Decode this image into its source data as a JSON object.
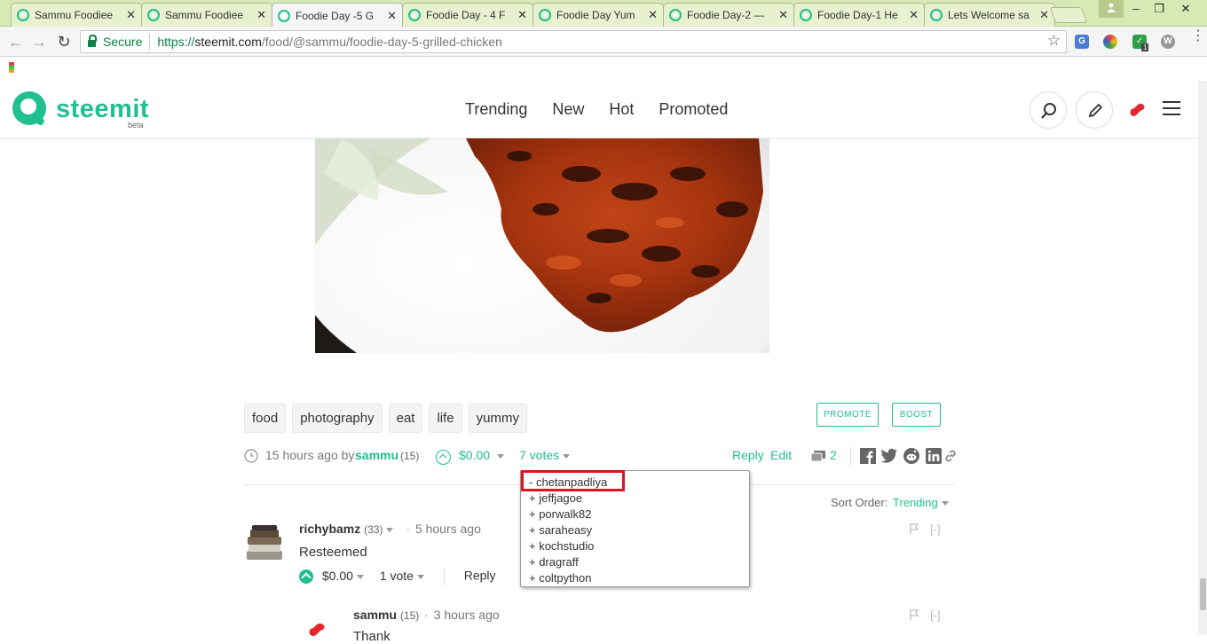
{
  "browser": {
    "tabs": [
      {
        "title": "Sammu Foodiee",
        "active": false
      },
      {
        "title": "Sammu Foodiee",
        "active": false
      },
      {
        "title": "Foodie Day -5 G",
        "active": true
      },
      {
        "title": "Foodie Day - 4 F",
        "active": false
      },
      {
        "title": "Foodie Day Yum",
        "active": false
      },
      {
        "title": "Foodie Day-2 —",
        "active": false
      },
      {
        "title": "Foodie Day-1 He",
        "active": false
      },
      {
        "title": "Lets Welcome sa",
        "active": false
      }
    ],
    "secure_label": "Secure",
    "url": {
      "proto": "https://",
      "host": "steemit.com",
      "path": "/food/@sammu/foodie-day-5-grilled-chicken"
    },
    "extension_badge": "1"
  },
  "site": {
    "logo_text": "steemit",
    "logo_beta": "beta",
    "nav": [
      "Trending",
      "New",
      "Hot",
      "Promoted"
    ]
  },
  "post": {
    "tags": [
      "food",
      "photography",
      "eat",
      "life",
      "yummy"
    ],
    "promote_label": "PROMOTE",
    "boost_label": "BOOST",
    "time": "15 hours ago by",
    "author": "sammu",
    "author_rep": "(15)",
    "payout": "$0.00",
    "votes_label": "7 votes",
    "reply_label": "Reply",
    "edit_label": "Edit",
    "comment_count": "2",
    "voters": [
      "- chetanpadliya",
      "+ jeffjagoe",
      "+ porwalk82",
      "+ saraheasy",
      "+ kochstudio",
      "+ dragraff",
      "+ coltpython"
    ]
  },
  "sort": {
    "label": "Sort Order:",
    "value": "Trending"
  },
  "comments": [
    {
      "author": "richybamz",
      "rep": "(33)",
      "time": "5 hours ago",
      "body": "Resteemed",
      "payout": "$0.00",
      "votes": "1 vote",
      "reply": "Reply",
      "collapse": "[-]"
    },
    {
      "author": "sammu",
      "rep": "(15)",
      "time": "3 hours ago",
      "body": "Thank",
      "collapse": "[-]"
    }
  ],
  "colors": {
    "accent": "#1fbf8f",
    "highlight": "#e0141e"
  }
}
